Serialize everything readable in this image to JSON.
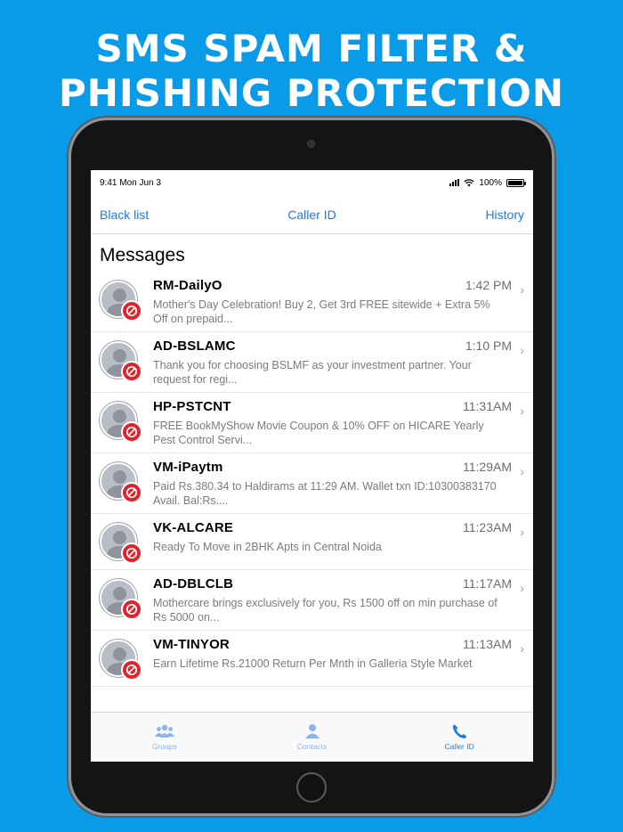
{
  "headline": {
    "line1": "SMS SPAM FILTER &",
    "line2": "PHISHING PROTECTION"
  },
  "status_bar": {
    "time": "9:41 Mon Jun 3",
    "battery": "100%",
    "battery_level": 1.0
  },
  "nav": {
    "left": "Black list",
    "title": "Caller ID",
    "right": "History"
  },
  "section_title": "Messages",
  "messages": [
    {
      "sender": "RM-DailyO",
      "time": "1:42 PM",
      "preview": "Mother's Day Celebration! Buy 2, Get 3rd FREE sitewide + Extra 5% Off on prepaid..."
    },
    {
      "sender": "AD-BSLAMC",
      "time": "1:10 PM",
      "preview": "Thank you for choosing BSLMF as your investment partner. Your request for regi..."
    },
    {
      "sender": "HP-PSTCNT",
      "time": "11:31AM",
      "preview": "FREE BookMyShow Movie Coupon & 10% OFF on HICARE Yearly Pest Control Servi..."
    },
    {
      "sender": "VM-iPaytm",
      "time": "11:29AM",
      "preview": "Paid Rs.380.34 to Haldirams at 11:29 AM. Wallet txn ID:10300383170 Avail. Bal:Rs...."
    },
    {
      "sender": "VK-ALCARE",
      "time": "11:23AM",
      "preview": "Ready To Move in 2BHK Apts in Central Noida"
    },
    {
      "sender": "AD-DBLCLB",
      "time": "11:17AM",
      "preview": "Mothercare brings exclusively for you, Rs 1500 off on min purchase of Rs 5000 on..."
    },
    {
      "sender": "VM-TINYOR",
      "time": "11:13AM",
      "preview": "Earn Lifetime Rs.21000 Return Per Mnth in Galleria Style Market"
    }
  ],
  "tabs": [
    {
      "label": "Groups",
      "icon": "groups-icon"
    },
    {
      "label": "Contacts",
      "icon": "contact-icon"
    },
    {
      "label": "Caller ID",
      "icon": "phone-icon"
    }
  ],
  "colors": {
    "background": "#0a9be8",
    "accent": "#1a7ce5",
    "block_badge": "#e0242b"
  }
}
